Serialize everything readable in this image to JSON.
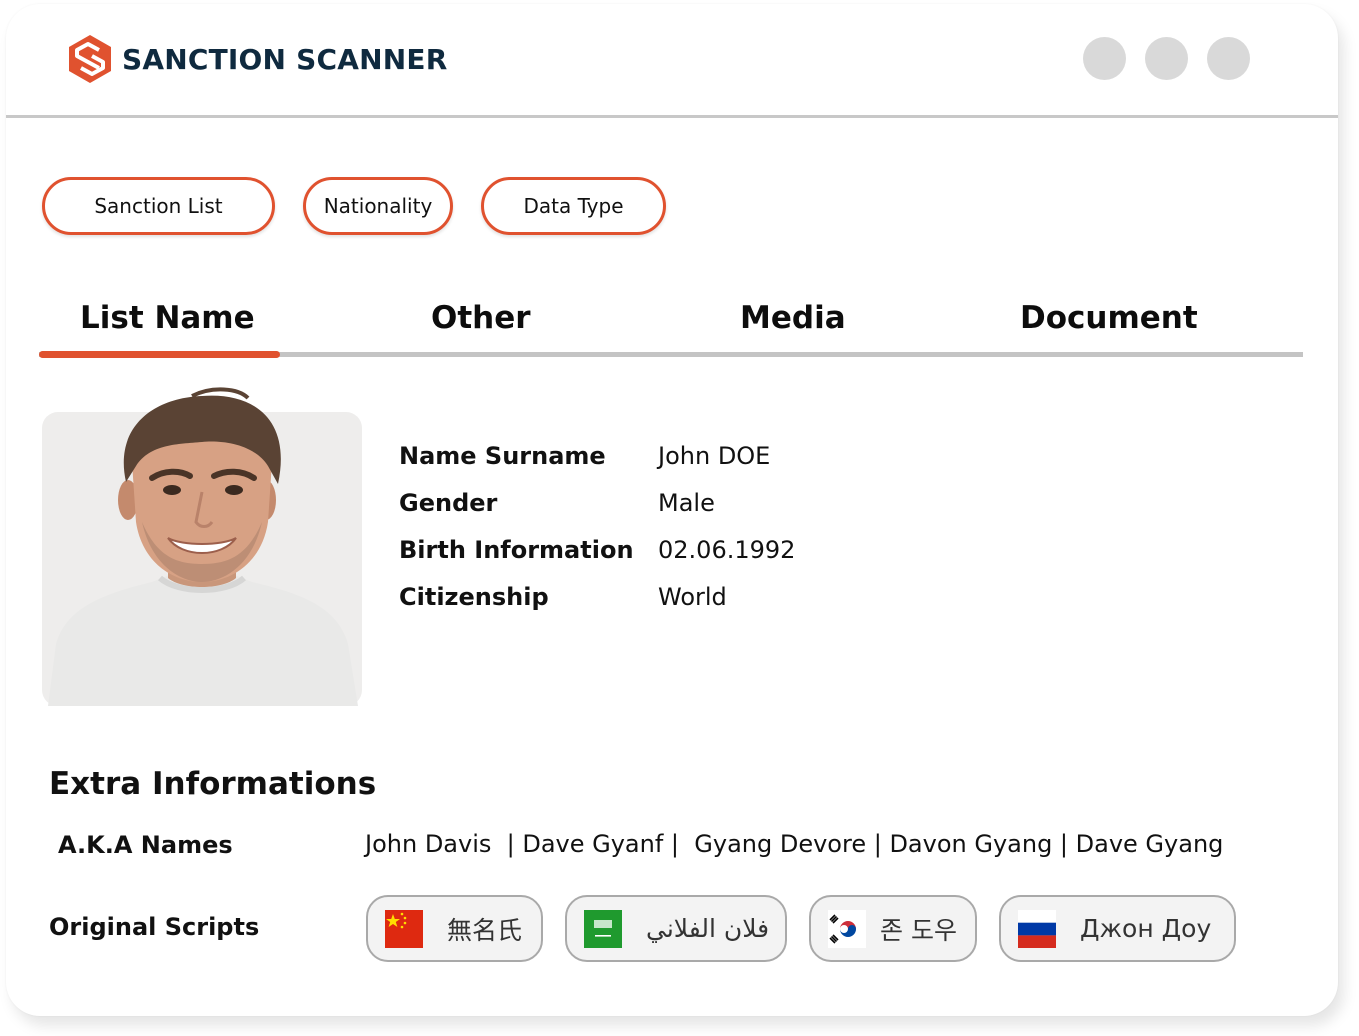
{
  "app": {
    "brand_name": "SANCTION SCANNER",
    "brand_color": "#e0522f",
    "brand_text_color": "#0f2a3f",
    "window_controls": [
      "window-dot",
      "window-dot",
      "window-dot"
    ]
  },
  "filters": [
    {
      "label": "Sanction List"
    },
    {
      "label": "Nationality"
    },
    {
      "label": "Data Type"
    }
  ],
  "tabs": {
    "active": "List Name",
    "items": [
      {
        "label": "List Name"
      },
      {
        "label": "Other"
      },
      {
        "label": "Media"
      },
      {
        "label": "Document"
      }
    ]
  },
  "profile": {
    "photo": "portrait-photo",
    "fields": [
      {
        "label": "Name Surname",
        "value": "John DOE"
      },
      {
        "label": "Gender",
        "value": "Male"
      },
      {
        "label": "Birth Information",
        "value": "02.06.1992"
      },
      {
        "label": "Citizenship",
        "value": "World"
      }
    ]
  },
  "extra": {
    "title": "Extra Informations",
    "aka_label": "A.K.A Names",
    "aka_names_text": "John Davis  | Dave Gyanf |  Gyang Devore | Davon Gyang | Dave Gyang",
    "aka_names": [
      "John Davis",
      "Dave Gyanf",
      "Gyang Devore",
      "Davon Gyang",
      "Dave Gyang"
    ],
    "scripts_label": "Original Scripts",
    "scripts": [
      {
        "flag": "china-flag-icon",
        "text": "無名氏"
      },
      {
        "flag": "saudi-arabia-flag-icon",
        "text": "فلان الفلاني"
      },
      {
        "flag": "south-korea-flag-icon",
        "text": "존 도우"
      },
      {
        "flag": "russia-flag-icon",
        "text": "Джон Доу"
      }
    ]
  }
}
